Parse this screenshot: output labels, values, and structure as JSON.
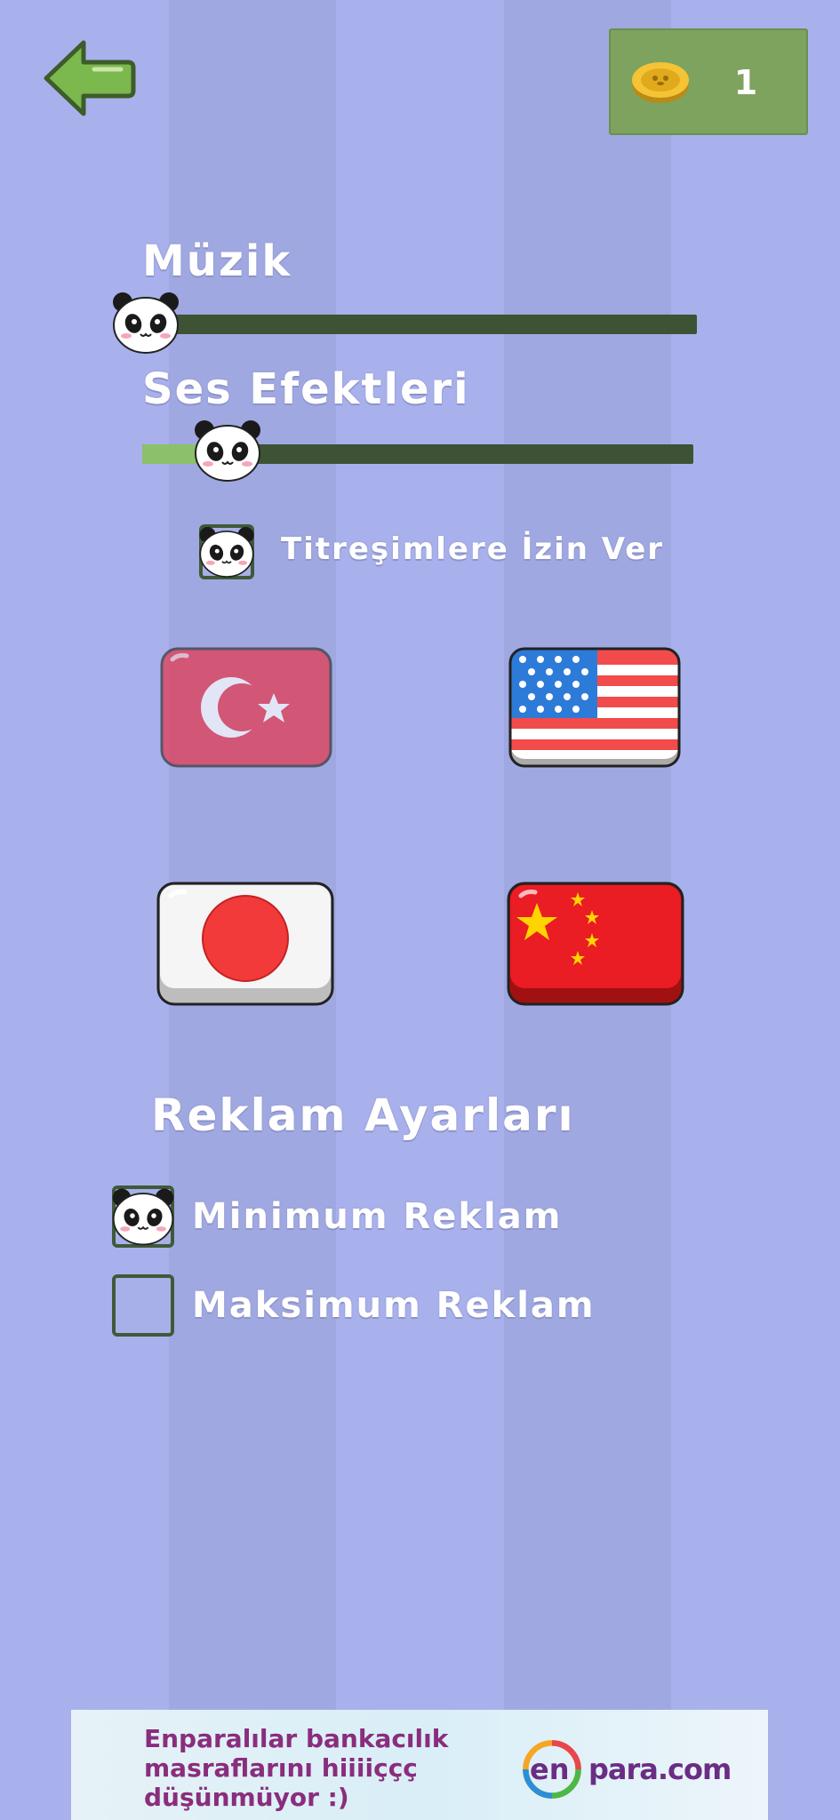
{
  "header": {
    "back_icon": "left-arrow-icon",
    "coin_icon": "coin-icon",
    "coin_count": "1"
  },
  "settings": {
    "music_label": "Müzik",
    "music_level": 0.0,
    "sfx_label": "Ses Efektleri",
    "sfx_level": 0.12,
    "vibration_label": "Titreşimlere İzin Ver",
    "vibration_checked": true
  },
  "languages": [
    {
      "name": "turkish",
      "icon": "turkey-flag-icon",
      "selected": true
    },
    {
      "name": "english",
      "icon": "usa-flag-icon",
      "selected": false
    },
    {
      "name": "japanese",
      "icon": "japan-flag-icon",
      "selected": false
    },
    {
      "name": "chinese",
      "icon": "china-flag-icon",
      "selected": false
    }
  ],
  "ads": {
    "title": "Reklam Ayarları",
    "min_label": "Minimum Reklam",
    "min_checked": true,
    "max_label": "Maksimum Reklam",
    "max_checked": false
  },
  "ad_banner": {
    "text": "Enparalılar bankacılık\nmasraflarını hiiiiççç\ndüşünmüyor :)",
    "logo_prefix": "en",
    "logo_text": "para.com"
  },
  "colors": {
    "background": "#a9b1ec",
    "slider_track": "#3d5334",
    "slider_fill": "#8cc06a",
    "coin_box": "#7ea35f",
    "checkbox_border": "#3f5a38"
  }
}
